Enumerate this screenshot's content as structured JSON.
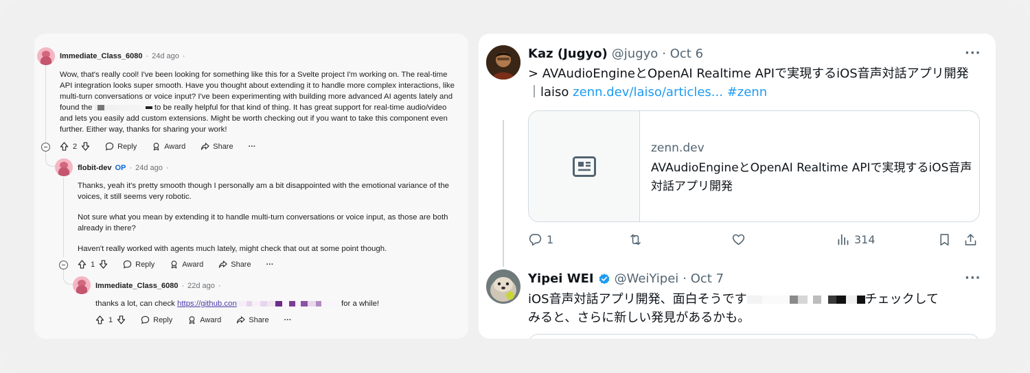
{
  "reddit": {
    "comments": [
      {
        "username": "Immediate_Class_6080",
        "time": "24d ago",
        "body_before": "Wow, that's really cool! I've been looking for something like this for a Svelte project I'm working on. The real-time API integration looks super smooth. Have you thought about extending it to handle more complex interactions, like multi-turn conversations or voice input? I've been experimenting with building more advanced AI agents lately and found the",
        "body_after": "to be really helpful for that kind of thing. It has great support for real-time audio/video and lets you easily add custom extensions. Might be worth checking out if you want to take this component even further. Either way, thanks for sharing your work!",
        "votes": "2"
      },
      {
        "username": "flobit-dev",
        "op_badge": "OP",
        "time": "24d ago",
        "paragraphs": [
          "Thanks, yeah it's pretty smooth though I personally am a bit disappointed with the emotional variance of the voices, it still seems very robotic.",
          "Not sure what you mean by extending it to handle multi-turn conversations or voice input, as those are both already in there?",
          "Haven't really worked with agents much lately, might check that out at some point though."
        ],
        "votes": "1"
      },
      {
        "username": "Immediate_Class_6080",
        "time": "22d ago",
        "body_before": "thanks a lot, can check",
        "link": "https://github.con",
        "body_after": "for a while!",
        "votes": "1"
      }
    ],
    "actions": {
      "reply": "Reply",
      "award": "Award",
      "share": "Share",
      "more": "···"
    }
  },
  "twitter": {
    "tweets": [
      {
        "name": "Kaz (Jugyo)",
        "handle": "@jugyo",
        "date": "· Oct 6",
        "text_line1": "> AVAudioEngineとOpenAI Realtime APIで実現するiOS音声対話アプリ開発",
        "text_line2_prefix": "｜laiso",
        "link": "zenn.dev/laiso/articles...",
        "hashtag": "#zenn",
        "card": {
          "domain": "zenn.dev",
          "title": "AVAudioEngineとOpenAI Realtime APIで実現するiOS音声対話アプリ開発"
        },
        "replies": "1",
        "views": "314"
      },
      {
        "name": "Yipei WEI",
        "handle": "@WeiYipei",
        "date": "· Oct 7",
        "text_line1_start": "iOS音声対話アプリ開発、面白そうです",
        "text_line1_end": "チェックして",
        "text_line2": "みると、さらに新しい発見があるかも。"
      }
    ],
    "more": "···",
    "colors": {
      "accent": "#1d9bf0",
      "text": "#0f1419",
      "secondary": "#536471"
    }
  }
}
